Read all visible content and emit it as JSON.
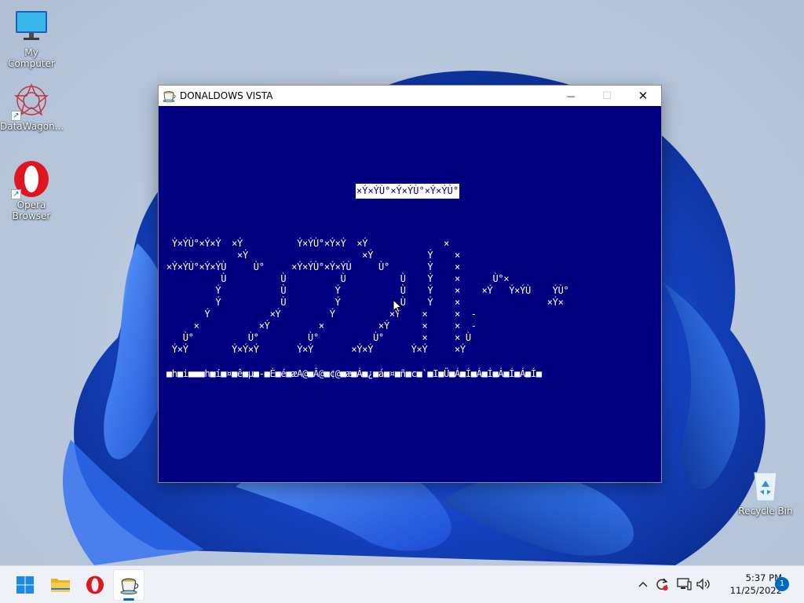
{
  "desktop": {
    "icons": [
      {
        "label": "My Computer"
      },
      {
        "label": "DataWagon..."
      },
      {
        "label": "Opera Browser"
      },
      {
        "label": "Recycle Bin"
      }
    ]
  },
  "window": {
    "title": "DONALDOWS VISTA",
    "minimize_glyph": "—",
    "maximize_glyph": "☐",
    "close_glyph": "✕"
  },
  "console": {
    "background": "#000080",
    "foreground": "#ffffff",
    "banner": "×Ý×ÝÙ°×Ý×ÝÙ°×Ý×ÝÙ°",
    "ascii_art": " Ý×ÝÙ°×Ý×Ý  ×Ý          Ý×ÝÙ°×Ý×Ý  ×Ý              ×\n             ×Ý                     ×Ý          Ý    ×\n×Ý×ÝÙ°×Ý×ÝÙ     Ù°     ×Ý×ÝÙ°×Ý×ÝÙ     Ù°       Ý    ×\n          Ù          Ù          Ù          Ù    Ý    ×      Ù°×\n         Ý           Ù         Ý           Ù    Ý    ×    ×Ý   Ý×ÝÙ    ÝÙ°\n         Ý           Ù         Ý           Ù    Ý    ×                ×Ý×\n       Ý           ×Ý         Ý          ×Ý    ×     ×  -\n     ×           ×Ý         ×          ×Ý      ×     ×  -\n   Ù°          Ù°         Ù°          Ù°       ×     × Ù\n Ý×Ý        Ý×Ý×Ý       Ý×Ý       ×Ý×Ý       Ý×Ý     ×Ý",
    "garbage_line": "■h■i■■■h■í■¤■ê■µ■-■È■é■æA@■Â@■¢@■æ■Á■¿■á■¤■ñ■c■`■I■Ü■Á■Í■Á■Í■Á■Í■Á■Í■"
  },
  "taskbar": {
    "items": [
      {
        "name": "start",
        "label": "Start"
      },
      {
        "name": "file-explorer",
        "label": "File Explorer"
      },
      {
        "name": "opera",
        "label": "Opera"
      },
      {
        "name": "donaldows-vista",
        "label": "DONALDOWS VISTA"
      }
    ],
    "tray": {
      "time": "5:37 PM",
      "date": "11/25/2022",
      "notifications": "1"
    }
  }
}
